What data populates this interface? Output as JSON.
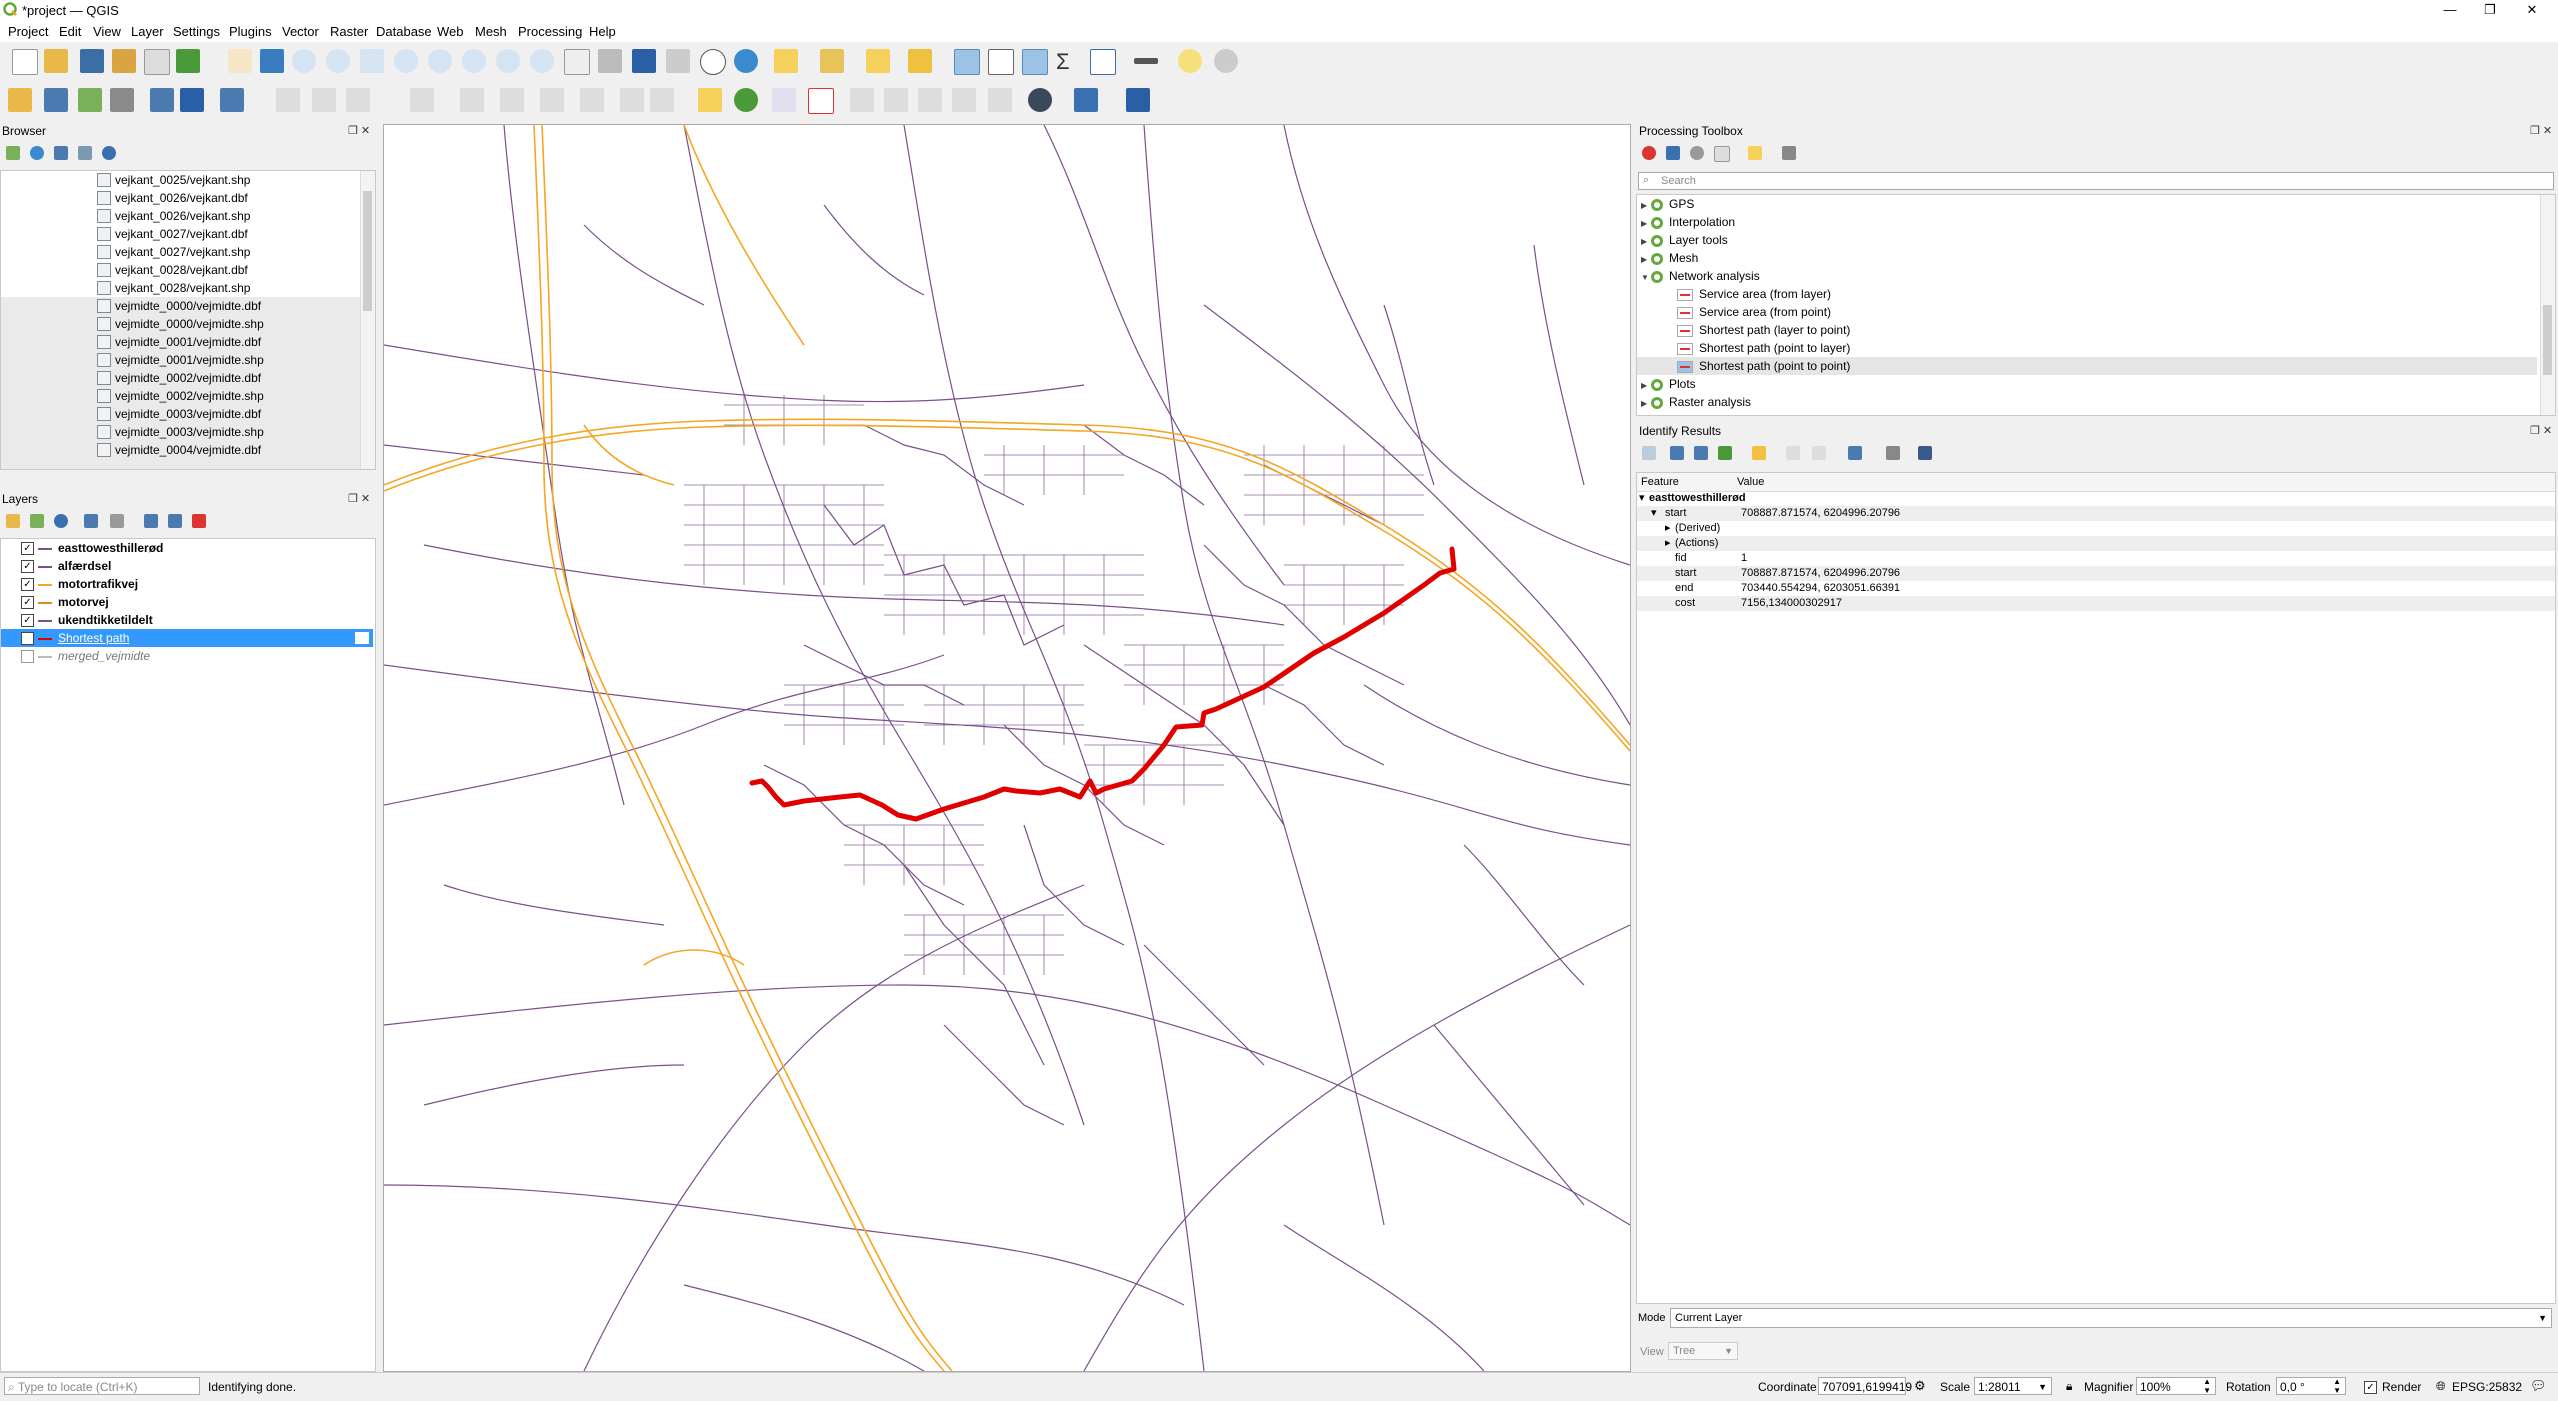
{
  "window": {
    "title": "*project — QGIS",
    "controls": [
      "—",
      "❐",
      "✕"
    ]
  },
  "menu": [
    "Project",
    "Edit",
    "View",
    "Layer",
    "Settings",
    "Plugins",
    "Vector",
    "Raster",
    "Database",
    "Web",
    "Mesh",
    "Processing",
    "Help"
  ],
  "browser": {
    "title": "Browser",
    "items": [
      "vejkant_0025/vejkant.shp",
      "vejkant_0026/vejkant.dbf",
      "vejkant_0026/vejkant.shp",
      "vejkant_0027/vejkant.dbf",
      "vejkant_0027/vejkant.shp",
      "vejkant_0028/vejkant.dbf",
      "vejkant_0028/vejkant.shp",
      "vejmidte_0000/vejmidte.dbf",
      "vejmidte_0000/vejmidte.shp",
      "vejmidte_0001/vejmidte.dbf",
      "vejmidte_0001/vejmidte.shp",
      "vejmidte_0002/vejmidte.dbf",
      "vejmidte_0002/vejmidte.shp",
      "vejmidte_0003/vejmidte.dbf",
      "vejmidte_0003/vejmidte.shp",
      "vejmidte_0004/vejmidte.dbf"
    ]
  },
  "layers": {
    "title": "Layers",
    "items": [
      {
        "name": "easttowesthillerød",
        "checked": true,
        "bold": true,
        "color": "#7a4f8a"
      },
      {
        "name": "alfærdsel",
        "checked": true,
        "bold": true,
        "color": "#7a4f8a"
      },
      {
        "name": "motortrafikvej",
        "checked": true,
        "bold": true,
        "color": "#f5a623"
      },
      {
        "name": "motorvej",
        "checked": true,
        "bold": true,
        "color": "#e08a1e"
      },
      {
        "name": "ukendtikketildelt",
        "checked": true,
        "bold": true,
        "color": "#7a4f8a"
      },
      {
        "name": "Shortest path",
        "checked": true,
        "bold": false,
        "selected": true,
        "color": "#e00000"
      },
      {
        "name": "merged_vejmidte",
        "checked": false,
        "bold": false,
        "italic": true,
        "color": "#999999"
      }
    ]
  },
  "processing": {
    "title": "Processing Toolbox",
    "search_placeholder": "Search",
    "groups": [
      {
        "label": "GPS",
        "expanded": false
      },
      {
        "label": "Interpolation",
        "expanded": false
      },
      {
        "label": "Layer tools",
        "expanded": false
      },
      {
        "label": "Mesh",
        "expanded": false
      },
      {
        "label": "Network analysis",
        "expanded": true
      },
      {
        "label": "Service area (from layer)",
        "child": true
      },
      {
        "label": "Service area (from point)",
        "child": true
      },
      {
        "label": "Shortest path (layer to point)",
        "child": true
      },
      {
        "label": "Shortest path (point to layer)",
        "child": true
      },
      {
        "label": "Shortest path (point to point)",
        "child": true,
        "selected": true
      },
      {
        "label": "Plots",
        "expanded": false
      },
      {
        "label": "Raster analysis",
        "expanded": false
      }
    ]
  },
  "identify": {
    "title": "Identify Results",
    "col_feature": "Feature",
    "col_value": "Value",
    "rows": [
      {
        "f": "easttowesthillerød",
        "v": "",
        "level": 0,
        "bold": true,
        "arrow": "▾"
      },
      {
        "f": "start",
        "v": "708887.871574, 6204996.20796",
        "level": 1,
        "arrow": "▾"
      },
      {
        "f": "(Derived)",
        "v": "",
        "level": 2,
        "arrow": "▸"
      },
      {
        "f": "(Actions)",
        "v": "",
        "level": 2,
        "arrow": "▸"
      },
      {
        "f": "fid",
        "v": "1",
        "level": 2,
        "arrow": ""
      },
      {
        "f": "start",
        "v": "708887.871574, 6204996.20796",
        "level": 2,
        "arrow": ""
      },
      {
        "f": "end",
        "v": "703440.554294, 6203051.66391",
        "level": 2,
        "arrow": ""
      },
      {
        "f": "cost",
        "v": "7156,134000302917",
        "level": 2,
        "arrow": ""
      }
    ],
    "mode_label": "Mode",
    "mode_value": "Current Layer",
    "view_label": "View",
    "view_value": "Tree"
  },
  "status": {
    "locate_placeholder": "Type to locate (Ctrl+K)",
    "message": "Identifying done.",
    "coordinate_label": "Coordinate",
    "coordinate_value": "707091,6199419",
    "scale_label": "Scale",
    "scale_value": "1:28011",
    "magnifier_label": "Magnifier",
    "magnifier_value": "100%",
    "rotation_label": "Rotation",
    "rotation_value": "0,0 °",
    "render_label": "Render",
    "crs": "EPSG:25832"
  },
  "colors": {
    "road": "#7a4f8a",
    "motorway": "#f5a623",
    "path": "#e00000",
    "selection": "#3399ff"
  }
}
